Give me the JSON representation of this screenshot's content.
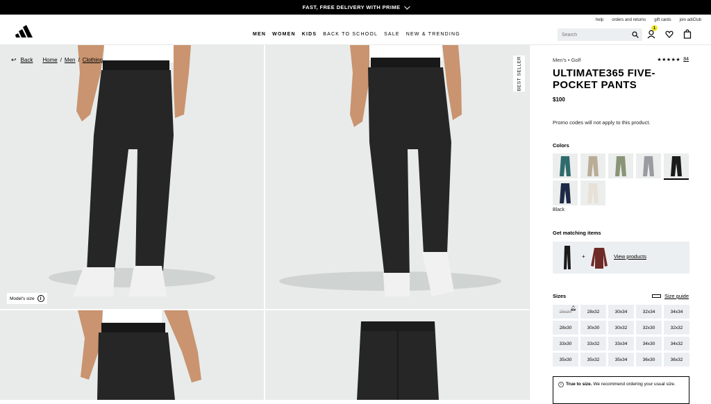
{
  "promo_bar": {
    "text": "FAST, FREE DELIVERY WITH PRIME"
  },
  "header": {
    "utility_links": [
      "help",
      "orders and returns",
      "gift cards",
      "join adiClub"
    ],
    "nav": [
      "MEN",
      "WOMEN",
      "KIDS",
      "BACK TO SCHOOL",
      "SALE",
      "NEW & TRENDING"
    ],
    "search_placeholder": "Search",
    "account_badge": "1"
  },
  "breadcrumb": {
    "back": "Back",
    "items": [
      "Home",
      "Men",
      "Clothing"
    ],
    "sep": "/"
  },
  "gallery": {
    "best_seller": "BEST SELLER",
    "model_size": "Model's size",
    "info_glyph": "i"
  },
  "product": {
    "category": "Men's • Golf",
    "stars": "★★★★★",
    "review_count": "84",
    "title": "ULTIMATE365 FIVE-POCKET PANTS",
    "price": "$100",
    "promo_note": "Promo codes will not apply to this product."
  },
  "colors": {
    "heading": "Colors",
    "selected_name": "Black",
    "swatches": [
      {
        "color": "#2f6b6e"
      },
      {
        "color": "#b9ad98"
      },
      {
        "color": "#8a9477"
      },
      {
        "color": "#9a9ba1"
      },
      {
        "color": "#1b1b1b"
      },
      {
        "color": "#1e2a45"
      },
      {
        "color": "#e7e1d6"
      }
    ]
  },
  "matching": {
    "heading": "Get matching items",
    "plus": "+",
    "link": "View products"
  },
  "sizes": {
    "heading": "Sizes",
    "guide": "Size guide",
    "items": [
      "28x34",
      "28x32",
      "30x34",
      "32x34",
      "34x34",
      "28x30",
      "30x30",
      "30x32",
      "32x30",
      "32x32",
      "33x30",
      "33x32",
      "33x34",
      "34x30",
      "34x32",
      "35x30",
      "35x32",
      "35x34",
      "36x30",
      "36x32"
    ],
    "out_of_stock": [
      "28x34"
    ]
  },
  "fit_note": {
    "bold": "True to size.",
    "text": " We recommend ordering your usual size."
  }
}
